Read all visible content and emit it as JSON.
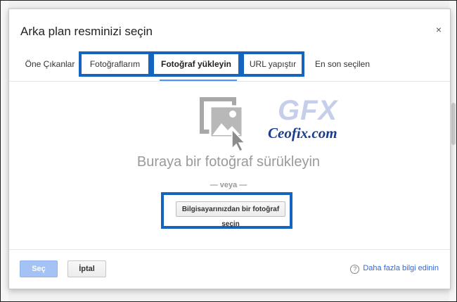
{
  "dialog": {
    "title": "Arka plan resminizi seçin",
    "close_icon": "close-icon",
    "close_glyph": "×"
  },
  "tabs": [
    {
      "label": "Öne Çıkanlar",
      "active": false,
      "highlighted": false
    },
    {
      "label": "Fotoğraflarım",
      "active": false,
      "highlighted": true
    },
    {
      "label": "Fotoğraf yükleyin",
      "active": true,
      "highlighted": true
    },
    {
      "label": "URL yapıştır",
      "active": false,
      "highlighted": true
    },
    {
      "label": "En son seçilen",
      "active": false,
      "highlighted": false
    }
  ],
  "upload": {
    "icon": "photo-drag-icon",
    "drag_text": "Buraya bir fotoğraf sürükleyin",
    "or_text": "— veya —",
    "choose_button": "Bilgisayarınızdan bir fotoğraf seçin"
  },
  "watermark": {
    "logo_text": "GFX",
    "site_text": "Ceofix.com"
  },
  "footer": {
    "select_button": "Seç",
    "cancel_button": "İptal",
    "help_icon": "question-circle-icon",
    "help_glyph": "?",
    "help_link": "Daha fazla bilgi edinin"
  },
  "colors": {
    "highlight_border": "#1565c0",
    "active_underline": "#4d90fe",
    "select_button_bg": "#a4c2f4",
    "link": "#3367d6"
  }
}
